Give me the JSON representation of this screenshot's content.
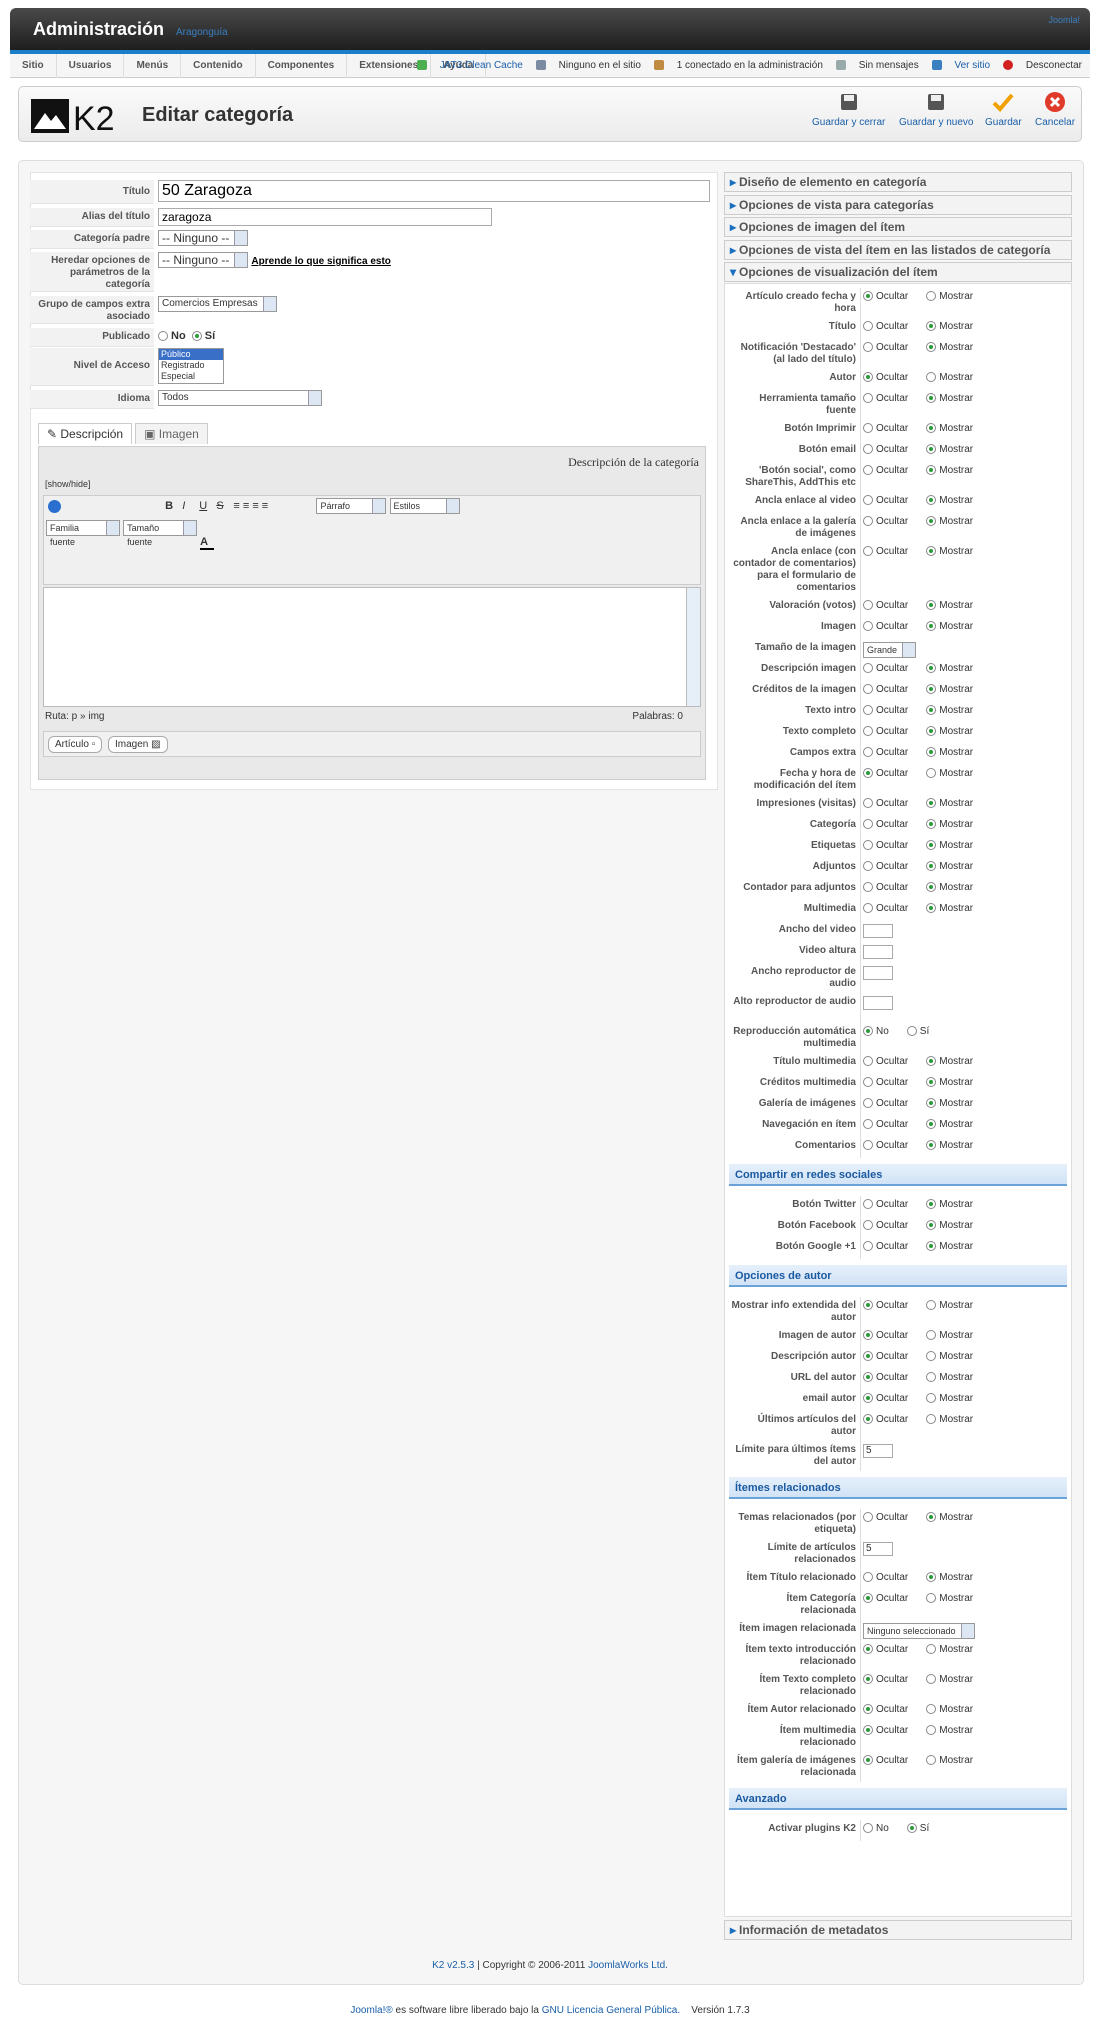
{
  "header": {
    "title": "Administración",
    "subtitle": "Aragonguía",
    "joomla": "Joomla!"
  },
  "menu": [
    "Sitio",
    "Usuarios",
    "Menús",
    "Contenido",
    "Componentes",
    "Extensiones",
    "Ayuda"
  ],
  "status": {
    "cache": "JAT3 Clean Cache",
    "online": "Ninguno en el sitio",
    "admins": "1 conectado en la administración",
    "messages": "Sin mensajes",
    "view": "Ver sitio",
    "logout": "Desconectar"
  },
  "toolbar": {
    "page_title": "Editar categoría",
    "buttons": [
      "Guardar y cerrar",
      "Guardar y nuevo",
      "Guardar",
      "Cancelar"
    ]
  },
  "form": {
    "title_label": "Título",
    "title_value": "50 Zaragoza",
    "alias_label": "Alias del título",
    "alias_value": "zaragoza",
    "parent_label": "Categoría padre",
    "parent_value": "-- Ninguno --",
    "inherit_label": "Heredar opciones de parámetros de la categoría",
    "inherit_value": "-- Ninguno --",
    "inherit_link": "Aprende lo que significa esto",
    "extra_label": "Grupo de campos extra asociado",
    "extra_value": "Comercios Empresas",
    "published_label": "Publicado",
    "no": "No",
    "yes": "Sí",
    "access_label": "Nivel de Acceso",
    "access_options": [
      "Público",
      "Registrado",
      "Especial"
    ],
    "lang_label": "Idioma",
    "lang_value": "Todos"
  },
  "tabs": [
    "Descripción",
    "Imagen"
  ],
  "editor": {
    "heading": "Descripción de la categoría",
    "toggle": "[show/hide]",
    "format": "Párrafo",
    "styles": "Estilos",
    "font_family": "Familia fuente",
    "font_size": "Tamaño fuente",
    "path": "Ruta:  p » img",
    "words": "Palabras: 0",
    "btn_article": "Artículo",
    "btn_image": "Imagen"
  },
  "accordions": [
    "Diseño de elemento en categoría",
    "Opciones de vista para categorías",
    "Opciones de imagen del ítem",
    "Opciones de vista del ítem en las listados de categoría",
    "Opciones de visualización del ítem"
  ],
  "accordion_bottom": "Información de metadatos",
  "radio": {
    "hide": "Ocultar",
    "show": "Mostrar",
    "no": "No",
    "yes": "Sí"
  },
  "options": [
    {
      "label": "Artículo creado fecha y hora",
      "type": "hs",
      "sel": "hide"
    },
    {
      "label": "Título",
      "type": "hs",
      "sel": "show"
    },
    {
      "label": "Notificación 'Destacado' (al lado del título)",
      "type": "hs",
      "sel": "show"
    },
    {
      "label": "Autor",
      "type": "hs",
      "sel": "hide"
    },
    {
      "label": "Herramienta tamaño fuente",
      "type": "hs",
      "sel": "show"
    },
    {
      "label": "Botón Imprimir",
      "type": "hs",
      "sel": "show"
    },
    {
      "label": "Botón email",
      "type": "hs",
      "sel": "show"
    },
    {
      "label": "'Botón social', como ShareThis, AddThis etc",
      "type": "hs",
      "sel": "show"
    },
    {
      "label": "Ancla enlace al video",
      "type": "hs",
      "sel": "show"
    },
    {
      "label": "Ancla enlace a la galería de imágenes",
      "type": "hs",
      "sel": "show"
    },
    {
      "label": "Ancla enlace (con contador de comentarios) para el formulario de comentarios",
      "type": "hs",
      "sel": "show"
    },
    {
      "label": "Valoración (votos)",
      "type": "hs",
      "sel": "show"
    },
    {
      "label": "Imagen",
      "type": "hs",
      "sel": "show"
    },
    {
      "label": "Tamaño de la imagen",
      "type": "select",
      "value": "Grande"
    },
    {
      "label": "Descripción imagen",
      "type": "hs",
      "sel": "show"
    },
    {
      "label": "Créditos de la imagen",
      "type": "hs",
      "sel": "show"
    },
    {
      "label": "Texto intro",
      "type": "hs",
      "sel": "show"
    },
    {
      "label": "Texto completo",
      "type": "hs",
      "sel": "show"
    },
    {
      "label": "Campos extra",
      "type": "hs",
      "sel": "show"
    },
    {
      "label": "Fecha y hora de modificación del ítem",
      "type": "hs",
      "sel": "hide"
    },
    {
      "label": "Impresiones (visitas)",
      "type": "hs",
      "sel": "show"
    },
    {
      "label": "Categoría",
      "type": "hs",
      "sel": "show"
    },
    {
      "label": "Etiquetas",
      "type": "hs",
      "sel": "show"
    },
    {
      "label": "Adjuntos",
      "type": "hs",
      "sel": "show"
    },
    {
      "label": "Contador para adjuntos",
      "type": "hs",
      "sel": "show"
    },
    {
      "label": "Multimedia",
      "type": "hs",
      "sel": "show"
    },
    {
      "label": "Ancho del video",
      "type": "box"
    },
    {
      "label": "Video altura",
      "type": "box"
    },
    {
      "label": "Ancho reproductor de audio",
      "type": "box"
    },
    {
      "label": "Alto reproductor de audio",
      "type": "box"
    },
    {
      "label": "Reproducción automática multimedia",
      "type": "ny",
      "sel": "no"
    },
    {
      "label": "Título multimedia",
      "type": "hs",
      "sel": "show"
    },
    {
      "label": "Créditos multimedia",
      "type": "hs",
      "sel": "show"
    },
    {
      "label": "Galería de imágenes",
      "type": "hs",
      "sel": "show"
    },
    {
      "label": "Navegación en ítem",
      "type": "hs",
      "sel": "show"
    },
    {
      "label": "Comentarios",
      "type": "hs",
      "sel": "show"
    },
    {
      "section": "Compartir en redes sociales"
    },
    {
      "label": "Botón Twitter",
      "type": "hs",
      "sel": "show"
    },
    {
      "label": "Botón Facebook",
      "type": "hs",
      "sel": "show"
    },
    {
      "label": "Botón Google +1",
      "type": "hs",
      "sel": "show"
    },
    {
      "section": "Opciones de autor"
    },
    {
      "label": "Mostrar info extendida del autor",
      "type": "hs",
      "sel": "hide"
    },
    {
      "label": "Imagen de autor",
      "type": "hs",
      "sel": "hide"
    },
    {
      "label": "Descripción autor",
      "type": "hs",
      "sel": "hide"
    },
    {
      "label": "URL del autor",
      "type": "hs",
      "sel": "hide"
    },
    {
      "label": "email autor",
      "type": "hs",
      "sel": "hide"
    },
    {
      "label": "Últimos artículos del autor",
      "type": "hs",
      "sel": "hide"
    },
    {
      "label": "Límite para últimos ítems del autor",
      "type": "text",
      "value": "5"
    },
    {
      "section": "Ítemes relacionados"
    },
    {
      "label": "Temas relacionados (por etiqueta)",
      "type": "hs",
      "sel": "show"
    },
    {
      "label": "Límite de artículos relacionados",
      "type": "text",
      "value": "5"
    },
    {
      "label": "Ítem Título relacionado",
      "type": "hs",
      "sel": "show"
    },
    {
      "label": "Ítem Categoría relacionada",
      "type": "hs",
      "sel": "hide"
    },
    {
      "label": "Ítem imagen relacionada",
      "type": "select",
      "value": "Ninguno seleccionado"
    },
    {
      "label": "Ítem texto introducción relacionado",
      "type": "hs",
      "sel": "hide"
    },
    {
      "label": "Ítem Texto completo relacionado",
      "type": "hs",
      "sel": "hide"
    },
    {
      "label": "Ítem Autor relacionado",
      "type": "hs",
      "sel": "hide"
    },
    {
      "label": "Ítem multimedia relacionado",
      "type": "hs",
      "sel": "hide"
    },
    {
      "label": "Ítem galería de imágenes relacionada",
      "type": "hs",
      "sel": "hide"
    },
    {
      "section": "Avanzado"
    },
    {
      "label": "Activar plugins K2",
      "type": "ny",
      "sel": "yes"
    }
  ],
  "footer": {
    "k2": "K2 v2.5.3",
    "copy": " | Copyright © 2006-2011 ",
    "jw": "JoomlaWorks Ltd.",
    "joomla": "Joomla!®",
    "free": " es software libre liberado bajo la ",
    "gpl": "GNU Licencia General Pública.",
    "version": "Versión 1.7.3"
  }
}
